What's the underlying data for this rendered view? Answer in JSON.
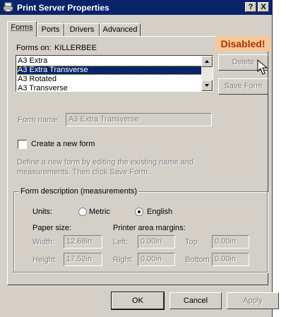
{
  "window": {
    "title": "Print Server Properties",
    "help_label": "?",
    "close_label": "X"
  },
  "tabs": [
    {
      "label": "Forms",
      "active": true
    },
    {
      "label": "Ports",
      "active": false
    },
    {
      "label": "Drivers",
      "active": false
    },
    {
      "label": "Advanced",
      "active": false
    }
  ],
  "forms_on": {
    "label": "Forms on:",
    "server": "KILLERBEE"
  },
  "forms_list": {
    "items": [
      "A3 Extra",
      "A3 Extra Transverse",
      "A3 Rotated",
      "A3 Transverse"
    ],
    "selected_index": 1
  },
  "annotation": {
    "text": "Disabled!"
  },
  "buttons": {
    "delete": "Delete",
    "save_form": "Save Form",
    "ok": "OK",
    "cancel": "Cancel",
    "apply": "Apply"
  },
  "form_name": {
    "label": "Form name:",
    "value": "A3 Extra Transverse"
  },
  "create_new_form": {
    "label": "Create a new form",
    "checked": false
  },
  "help_text": {
    "line1": "Define a new form by editing the existing name and",
    "line2": "measurements.  Then click Save Form."
  },
  "measurements": {
    "group_label": "Form description (measurements)",
    "units_label": "Units:",
    "metric_label": "Metric",
    "english_label": "English",
    "selected_unit": "English",
    "paper_size_label": "Paper size:",
    "width_label": "Width:",
    "width_value": "12.68in",
    "height_label": "Height:",
    "height_value": "17.52in",
    "margins_label": "Printer area margins:",
    "left_label": "Left:",
    "left_value": "0.00in",
    "right_label": "Right:",
    "right_value": "0.00in",
    "top_label": "Top:",
    "top_value": "0.00in",
    "bottom_label": "Bottom:",
    "bottom_value": "0.00in"
  },
  "colors": {
    "titlebar": "#0a246a",
    "face": "#d4d0c8",
    "selection": "#0a246a",
    "annotation_bg": "#f7c89a",
    "annotation_fg": "#b03000"
  }
}
